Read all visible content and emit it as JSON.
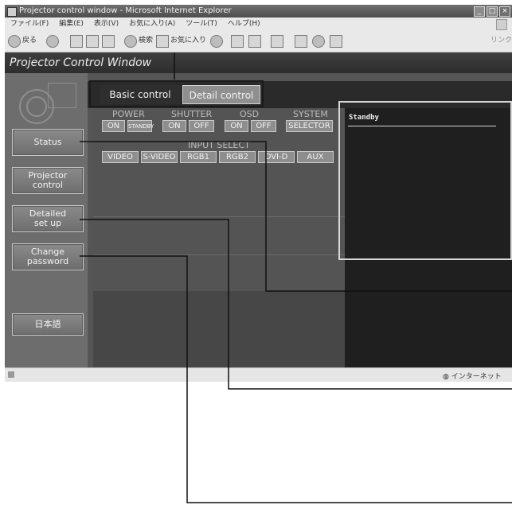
{
  "window": {
    "title": "Projector control window - Microsoft Internet Explorer",
    "buttons": [
      "_",
      "□",
      "×"
    ]
  },
  "menu": [
    "ファイル(F)",
    "編集(E)",
    "表示(V)",
    "お気に入り(A)",
    "ツール(T)",
    "ヘルプ(H)"
  ],
  "toolbar": {
    "back_label": "戻る",
    "search_label": "検索",
    "favorites_label": "お気に入り",
    "links_label": "リンク"
  },
  "app": {
    "header": "Projector Control Window",
    "tabs": {
      "basic": "Basic control",
      "detail": "Detail control"
    },
    "sidebar": {
      "status": "Status",
      "projector_control": "Projector\ncontrol",
      "detailed_setup": "Detailed\nset up",
      "change_password": "Change\npassword",
      "japanese": "日本語"
    },
    "groups": {
      "power": {
        "label": "POWER",
        "on": "ON",
        "standby": "STANDBY"
      },
      "shutter": {
        "label": "SHUTTER",
        "on": "ON",
        "off": "OFF"
      },
      "osd": {
        "label": "OSD",
        "on": "ON",
        "off": "OFF"
      },
      "system": {
        "label": "SYSTEM",
        "selector": "SELECTOR"
      },
      "input_select": {
        "label": "INPUT SELECT",
        "inputs": [
          "VIDEO",
          "S-VIDEO",
          "RGB1",
          "RGB2",
          "DVI-D",
          "AUX"
        ]
      }
    },
    "monitor": {
      "status_text": "Standby"
    }
  },
  "statusbar": {
    "zone": "インターネット"
  }
}
